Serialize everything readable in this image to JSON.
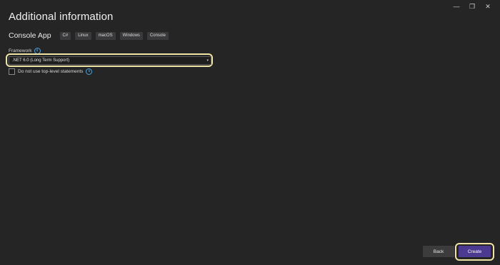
{
  "window": {
    "minimize_glyph": "—",
    "restore_glyph": "❐",
    "close_glyph": "✕"
  },
  "page": {
    "title": "Additional information",
    "subtitle": "Console App",
    "tags": [
      "C#",
      "Linux",
      "macOS",
      "Windows",
      "Console"
    ]
  },
  "framework": {
    "label": "Framework",
    "info_glyph": "i",
    "selected": ".NET 6.0 (Long Term Support)",
    "chevron_glyph": "▾"
  },
  "options": {
    "top_level_statements_label": "Do not use top-level statements",
    "top_level_statements_checked": false
  },
  "footer": {
    "back_label": "Back",
    "create_label": "Create"
  },
  "colors": {
    "background": "#252526",
    "accent_button": "#4b3a8f",
    "highlight": "#efe3a6",
    "info_icon": "#4fa3e0"
  }
}
